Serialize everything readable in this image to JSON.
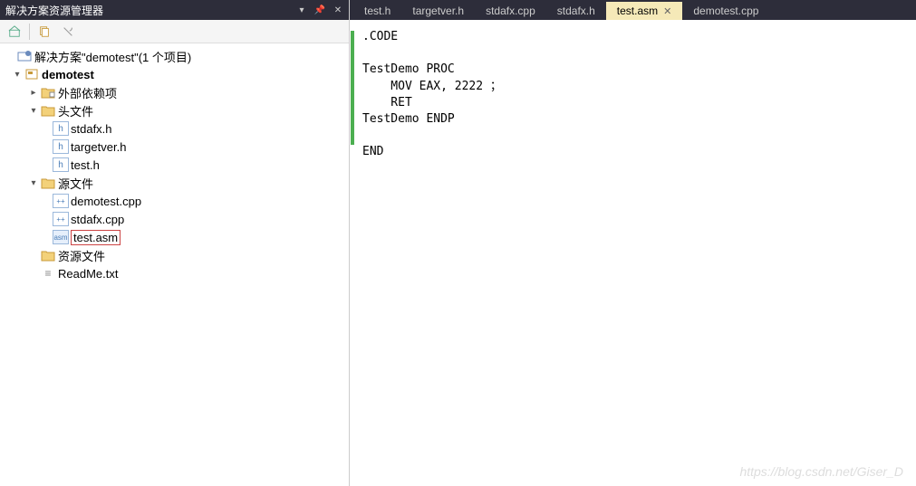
{
  "sidebar": {
    "title": "解决方案资源管理器",
    "solution_label": "解决方案\"demotest\"(1 个项目)",
    "project": "demotest",
    "folders": {
      "external": "外部依赖项",
      "headers": "头文件",
      "sources": "源文件",
      "resources": "资源文件"
    },
    "header_files": [
      "stdafx.h",
      "targetver.h",
      "test.h"
    ],
    "source_files": [
      "demotest.cpp",
      "stdafx.cpp",
      "test.asm"
    ],
    "other_files": [
      "ReadMe.txt"
    ]
  },
  "tabs": [
    {
      "label": "test.h",
      "active": false
    },
    {
      "label": "targetver.h",
      "active": false
    },
    {
      "label": "stdafx.cpp",
      "active": false
    },
    {
      "label": "stdafx.h",
      "active": false
    },
    {
      "label": "test.asm",
      "active": true
    },
    {
      "label": "demotest.cpp",
      "active": false
    }
  ],
  "code_lines": [
    ".CODE",
    "",
    "TestDemo PROC",
    "    MOV EAX, 2222 ；",
    "    RET",
    "TestDemo ENDP",
    "",
    "END"
  ],
  "watermark": "https://blog.csdn.net/Giser_D"
}
